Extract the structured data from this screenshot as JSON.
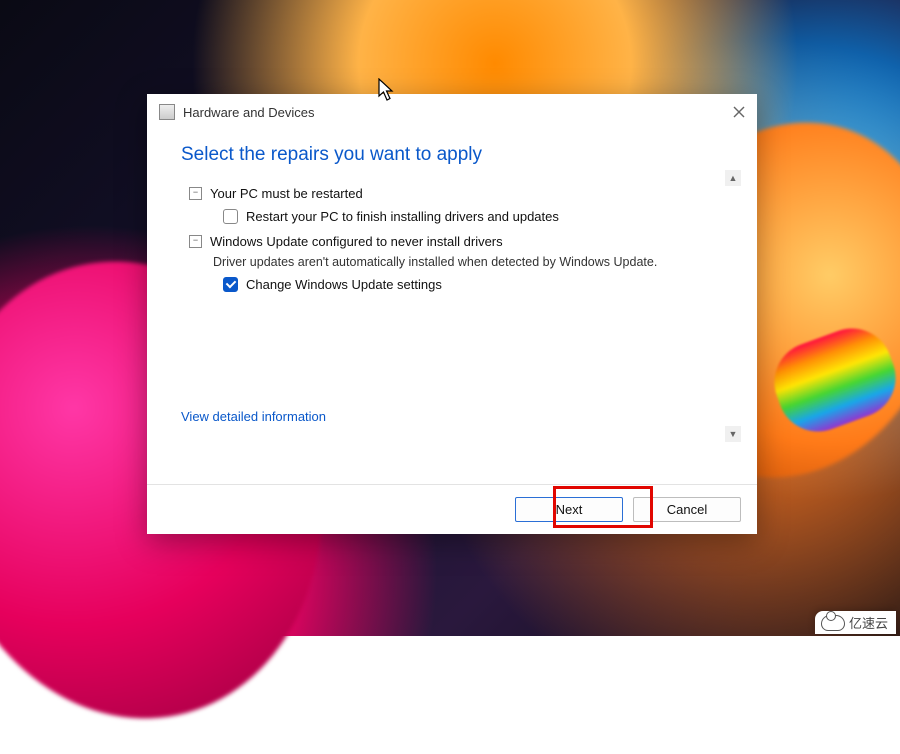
{
  "window": {
    "title": "Hardware and Devices"
  },
  "heading": "Select the repairs you want to apply",
  "groups": [
    {
      "title": "Your PC must be restarted",
      "option_label": "Restart your PC to finish installing drivers and updates",
      "option_checked": false
    },
    {
      "title": "Windows Update configured to never install drivers",
      "description": "Driver updates aren't automatically installed when detected by Windows Update.",
      "option_label": "Change Windows Update settings",
      "option_checked": true
    }
  ],
  "detail_link": "View detailed information",
  "buttons": {
    "next": "Next",
    "cancel": "Cancel"
  },
  "watermark": "亿速云"
}
